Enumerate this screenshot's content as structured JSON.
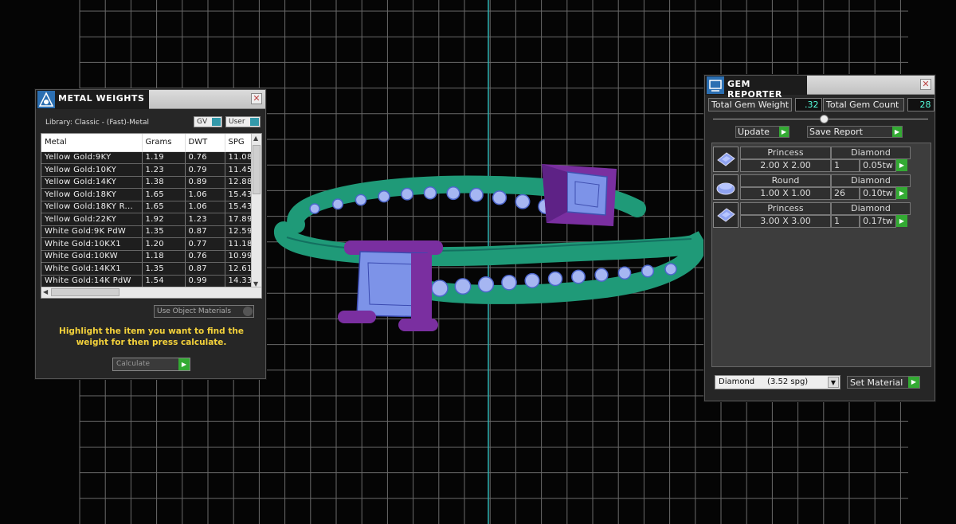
{
  "metal_weights": {
    "title": "METAL WEIGHTS",
    "library_label": "Library: Classic - (Fast)-Metal",
    "toggle_gv": "GV",
    "toggle_user": "User",
    "columns": [
      "Metal",
      "Grams",
      "DWT",
      "SPG"
    ],
    "rows": [
      [
        "Yellow Gold:9KY",
        "1.19",
        "0.76",
        "11.08"
      ],
      [
        "Yellow Gold:10KY",
        "1.23",
        "0.79",
        "11.45"
      ],
      [
        "Yellow Gold:14KY",
        "1.38",
        "0.89",
        "12.88"
      ],
      [
        "Yellow Gold:18KY",
        "1.65",
        "1.06",
        "15.43"
      ],
      [
        "Yellow Gold:18KY R...",
        "1.65",
        "1.06",
        "15.43"
      ],
      [
        "Yellow Gold:22KY",
        "1.92",
        "1.23",
        "17.89"
      ],
      [
        "White Gold:9K PdW",
        "1.35",
        "0.87",
        "12.59"
      ],
      [
        "White Gold:10KX1",
        "1.20",
        "0.77",
        "11.18"
      ],
      [
        "White Gold:10KW",
        "1.18",
        "0.76",
        "10.99"
      ],
      [
        "White Gold:14KX1",
        "1.35",
        "0.87",
        "12.61"
      ],
      [
        "White Gold:14K PdW",
        "1.54",
        "0.99",
        "14.33"
      ]
    ],
    "object_materials": "Use Object Materials",
    "hint": "Highlight the item you want to find the weight for then press calculate.",
    "calculate_label": "Calculate"
  },
  "gem_reporter": {
    "title": "GEM REPORTER",
    "total_weight_label": "Total Gem Weight",
    "total_weight_value": ".32",
    "total_count_label": "Total Gem Count",
    "total_count_value": "28",
    "update_label": "Update",
    "save_report_label": "Save Report",
    "gems": [
      {
        "shape": "Princess",
        "size": "2.00 X 2.00",
        "material": "Diamond",
        "count": "1",
        "weight": "0.05tw",
        "icon": "princess-gem-icon"
      },
      {
        "shape": "Round",
        "size": "1.00 X 1.00",
        "material": "Diamond",
        "count": "26",
        "weight": "0.10tw",
        "icon": "round-gem-icon"
      },
      {
        "shape": "Princess",
        "size": "3.00 X 3.00",
        "material": "Diamond",
        "count": "1",
        "weight": "0.17tw",
        "icon": "princess-gem-icon"
      }
    ],
    "material_select": "Diamond     (3.52 spg)",
    "set_material_label": "Set Material"
  },
  "colors": {
    "grid": "#6a6a6a",
    "axis_cyan": "#2fb3b3",
    "ring_green": "#1f9a78",
    "prong_purple": "#7a2fa0",
    "gem_blue": "#7d93e8",
    "accent_green": "#33aa33",
    "hint_yellow": "#f4d23b"
  }
}
